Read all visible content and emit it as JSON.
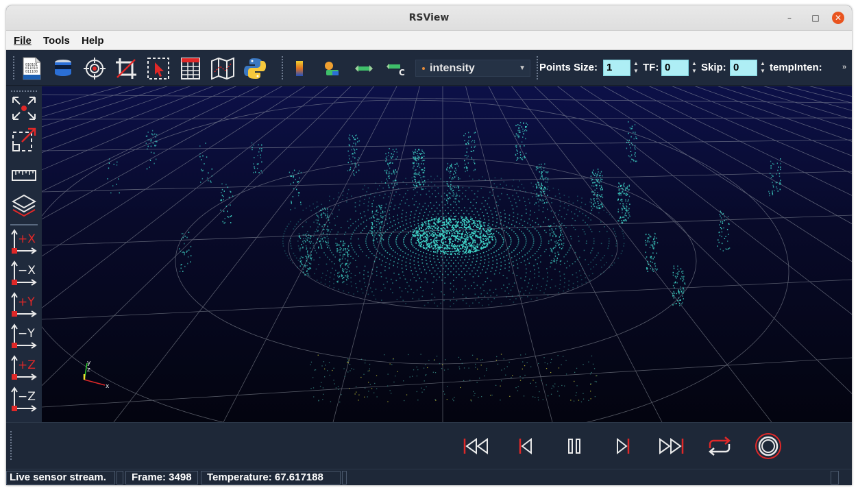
{
  "window": {
    "title": "RSView"
  },
  "menu": {
    "items": [
      "File",
      "Tools",
      "Help"
    ]
  },
  "toolbar": {
    "open_file_icon": "binary-file-icon",
    "sensor_icon": "lidar-sensor-icon",
    "color_combo_value": "intensity",
    "points_size_label": "Points Size:",
    "points_size_value": "1",
    "tf_label": "TF:",
    "tf_value": "0",
    "skip_label": "Skip:",
    "skip_value": "0",
    "temp_inten_label": "tempInten:",
    "overflow_symbol": "»"
  },
  "left_toolbar": {
    "axis_buttons": [
      "+X",
      "−X",
      "+Y",
      "−Y",
      "+Z",
      "−Z"
    ]
  },
  "viewport": {
    "axes_labels": {
      "x": "x",
      "y": "y",
      "z": "z"
    },
    "colors": {
      "points": "#3fd3c6",
      "grid": "#9aa0aa",
      "background": "#0a0e3a"
    }
  },
  "playback": {
    "buttons": [
      "first-frame",
      "previous-frame",
      "pause",
      "next-frame",
      "last-frame",
      "loop",
      "record"
    ]
  },
  "status": {
    "message": "Live sensor stream.",
    "frame": "Frame: 3498",
    "temperature": "Temperature: 67.617188"
  },
  "colors": {
    "accent_red": "#e02828",
    "panel": "#1e2838",
    "spin_bg": "#aeeef5"
  }
}
